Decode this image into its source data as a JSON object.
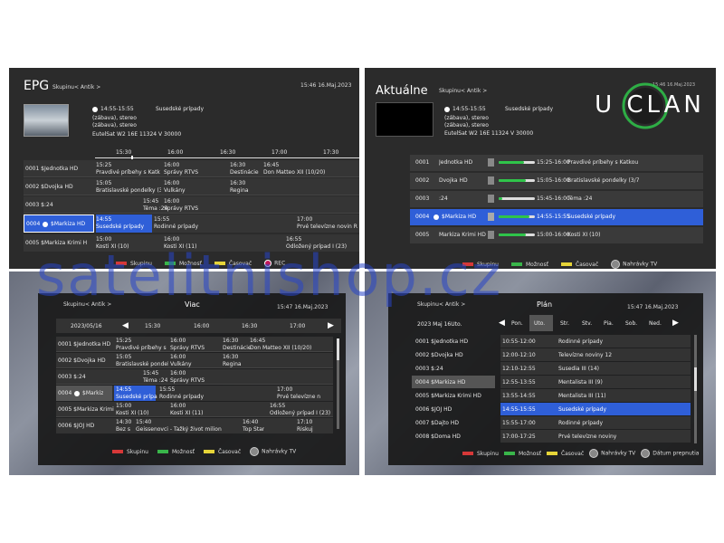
{
  "watermark": "satelitnishop.cz",
  "epg": {
    "title": "EPG",
    "group": "Skupinu< Antik >",
    "datetime": "15:46  16.Maj.2023",
    "info_time": "14:55-15:55",
    "info_name": "Susedské prípady",
    "info_line1": "(zábava), stereo",
    "info_line2": "(zábava), stereo",
    "sat": "EutelSat W2 16E  11324 V 30000",
    "times": [
      "15:30",
      "16:00",
      "16:30",
      "17:00",
      "17:30"
    ],
    "rows": [
      {
        "ch": "0001  $Jednotka HD",
        "e": [
          {
            "t": "15:25",
            "n": "Pravdivé príbehy s Katk"
          },
          {
            "t": "16:00",
            "n": "Správy RTVS"
          },
          {
            "t": "16:30",
            "n": "Destinácie"
          },
          {
            "t": "16:45",
            "n": "Don Matteo XII (10/20)"
          }
        ]
      },
      {
        "ch": "0002  $Dvojka HD",
        "e": [
          {
            "t": "15:05",
            "n": "Bratislavské pondelky (3"
          },
          {
            "t": "16:00",
            "n": "Vulkány"
          },
          {
            "t": "16:30",
            "n": "Regina"
          }
        ]
      },
      {
        "ch": "0003  $:24",
        "e": [
          {
            "t": "15:45",
            "n": "Téma :24"
          },
          {
            "t": "16:00",
            "n": "Správy RTVS"
          }
        ]
      },
      {
        "ch": "0004",
        "ch2": "$Markiza HD",
        "e": [
          {
            "t": "14:55",
            "n": "Susedské prípady"
          },
          {
            "t": "15:55",
            "n": "Rodinné prípady"
          },
          {
            "t": "17:00",
            "n": "Prvé televízne novin  R"
          }
        ]
      },
      {
        "ch": "0005  $Markiza Krimi H",
        "e": [
          {
            "t": "15:00",
            "n": "Kosti XI (10)"
          },
          {
            "t": "16:00",
            "n": "Kosti XI (11)"
          },
          {
            "t": "16:55",
            "n": "Odložený prípad I (23)"
          }
        ]
      }
    ],
    "legend": [
      "Skupinu",
      "Možnosť",
      "Časovač",
      "REC"
    ]
  },
  "akt": {
    "title": "Aktuálne",
    "group": "Skupinu< Antik >",
    "logo": "U CLAN",
    "info_time": "14:55-15:55",
    "info_name": "Susedské prípady",
    "info_line1": "(zábava), stereo",
    "info_line2": "(zábava), stereo",
    "sat": "EutelSat W2 16E  11324 V 30000",
    "clock": "15:46 16.Maj.2023",
    "rows": [
      {
        "num": "0001",
        "ch": "Jednotka HD",
        "time": "15:25-16:00",
        "name": "Pravdivé príbehy s Katkou",
        "progress": 0.7
      },
      {
        "num": "0002",
        "ch": "Dvojka HD",
        "time": "15:05-16:00",
        "name": "Bratislavské pondelky (3/7",
        "progress": 0.75
      },
      {
        "num": "0003",
        "ch": ":24",
        "time": "15:45-16:00",
        "name": "Téma :24",
        "progress": 0.1
      },
      {
        "num": "0004",
        "ch": "$Markiza HD",
        "time": "14:55-15:55",
        "name": "Susedské prípady",
        "progress": 0.85
      },
      {
        "num": "0005",
        "ch": "Markiza Krimi HD",
        "time": "15:00-16:00",
        "name": "Kosti XI (10)",
        "progress": 0.75
      }
    ],
    "legend": [
      "Skupinu",
      "Možnosť",
      "Časovač",
      "Nahrávky TV"
    ]
  },
  "viac": {
    "group": "Skupinu< Antik >",
    "title": "Viac",
    "datetime": "15:47  16.Maj.2023",
    "date": "2023/05/16",
    "times": [
      "15:30",
      "16:00",
      "16:30",
      "17:00"
    ],
    "rows": [
      {
        "ch": "0001  $Jednotka HD",
        "e": [
          {
            "t": "15:25",
            "n": "Pravdivé príbehy s"
          },
          {
            "t": "16:00",
            "n": "Správy RTVS"
          },
          {
            "t": "16:30",
            "n": "Destinácie"
          },
          {
            "t": "16:45",
            "n": "Don Matteo XII (10/20)"
          }
        ]
      },
      {
        "ch": "0002  $Dvojka HD",
        "e": [
          {
            "t": "15:05",
            "n": "Bratislavské pondel"
          },
          {
            "t": "16:00",
            "n": "Vulkány"
          },
          {
            "t": "16:30",
            "n": "Regina"
          }
        ]
      },
      {
        "ch": "0003  $:24",
        "e": [
          {
            "t": "15:45",
            "n": "Téma :24"
          },
          {
            "t": "16:00",
            "n": "Správy RTVS"
          }
        ]
      },
      {
        "ch": "0004",
        "ch2": "$Markiz",
        "e": [
          {
            "t": "14:55",
            "n": "Susedské prípa"
          },
          {
            "t": "15:55",
            "n": "Rodinné prípady"
          },
          {
            "t": "17:00",
            "n": "Prvé televízne n"
          }
        ]
      },
      {
        "ch": "0005  $Markiza Krimi",
        "e": [
          {
            "t": "15:00",
            "n": "Kosti XI (10)"
          },
          {
            "t": "16:00",
            "n": "Kosti XI (11)"
          },
          {
            "t": "16:55",
            "n": "Odložený prípad I (23)"
          }
        ]
      },
      {
        "ch": "0006  $JOJ HD",
        "e": [
          {
            "t": "14:30",
            "n": "Bez s"
          },
          {
            "t": "15:40",
            "n": "Geissenovci - Ťažký život milion"
          },
          {
            "t": "16:40",
            "n": "Top Star"
          },
          {
            "t": "17:10",
            "n": "Riskuj"
          }
        ]
      }
    ],
    "legend": [
      "Skupinu",
      "Možnosť",
      "Časovač",
      "Nahrávky TV"
    ]
  },
  "plan": {
    "group": "Skupinu< Antik >",
    "title": "Plán",
    "datetime": "15:47  16.Maj.2023",
    "date": "2023 Maj 16Uto.",
    "days": [
      "Pon.",
      "Uto.",
      "Str.",
      "Štv.",
      "Pia.",
      "Sob.",
      "Ned."
    ],
    "channels": [
      "0001  $Jednotka HD",
      "0002  $Dvojka HD",
      "0003  $:24",
      "0004  $Markiza HD",
      "0005  $Markiza Krimi HD",
      "0006  $JOJ HD",
      "0007  $Dajto HD",
      "0008  $Doma HD"
    ],
    "events": [
      {
        "t": "10:55-12:00",
        "n": "Rodinné prípady"
      },
      {
        "t": "12:00-12:10",
        "n": "Televízne noviny 12"
      },
      {
        "t": "12:10-12:55",
        "n": "Susedia III (14)"
      },
      {
        "t": "12:55-13:55",
        "n": "Mentalista III (9)"
      },
      {
        "t": "13:55-14:55",
        "n": "Mentalista III (11)"
      },
      {
        "t": "14:55-15:55",
        "n": "Susedské prípady"
      },
      {
        "t": "15:55-17:00",
        "n": "Rodinné prípady"
      },
      {
        "t": "17:00-17:25",
        "n": "Prvé televízne noviny"
      }
    ],
    "legend": [
      "Skupinu",
      "Možnosť",
      "Časovač",
      "Nahrávky TV",
      "Dátum prepnutia"
    ]
  }
}
